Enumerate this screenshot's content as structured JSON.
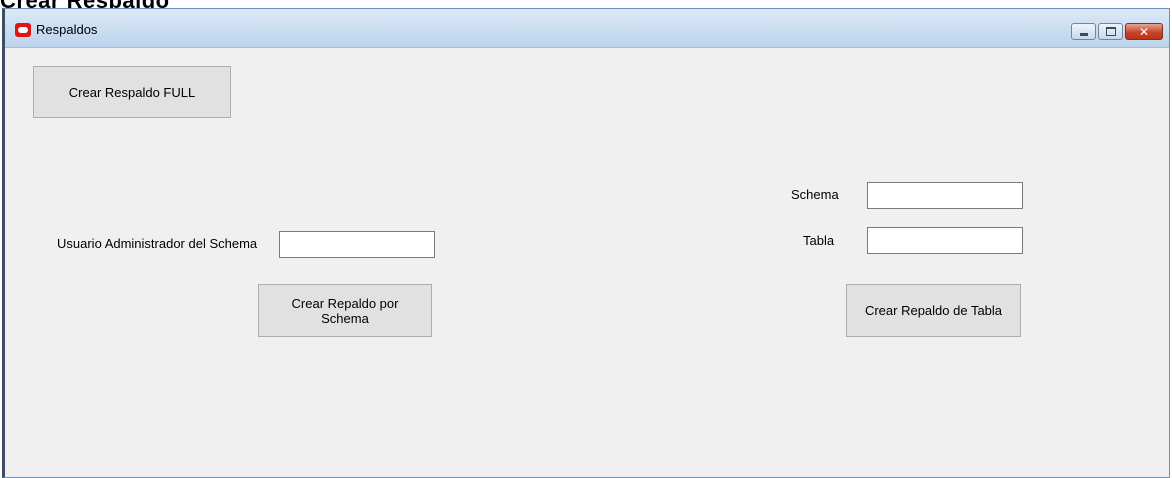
{
  "window": {
    "title": "Respaldos",
    "controls": {
      "minimize": "–",
      "maximize": "□",
      "close": "✕"
    }
  },
  "background_heading": "Crear Respaldo",
  "buttons": {
    "full_backup": "Crear Respaldo FULL",
    "schema_backup": "Crear Repaldo por Schema",
    "table_backup": "Crear Repaldo de Tabla"
  },
  "labels": {
    "schema_admin_user": "Usuario Administrador del Schema",
    "schema": "Schema",
    "table": "Tabla"
  },
  "fields": {
    "schema_admin_user": "",
    "schema": "",
    "table": ""
  }
}
